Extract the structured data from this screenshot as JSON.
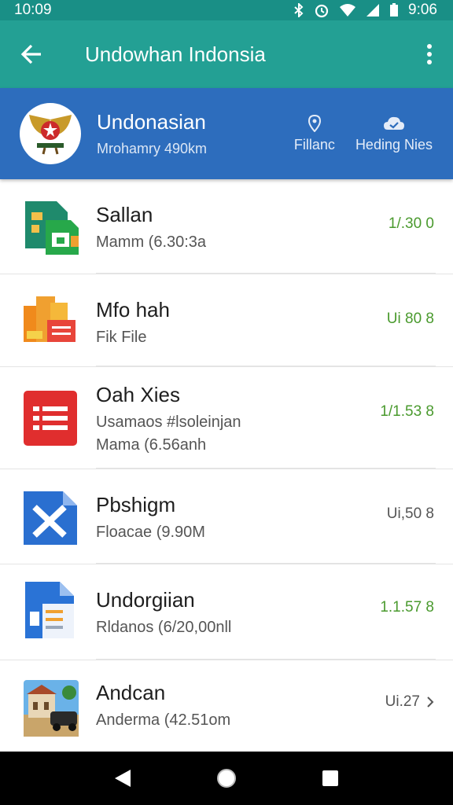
{
  "status_bar": {
    "time_left": "10:09",
    "time_right": "9:06"
  },
  "app_bar": {
    "title": "Undowhan Indonsia"
  },
  "account": {
    "name": "Undonasian",
    "meta": "Mrohamry 490km",
    "actions": [
      {
        "label": "Fillanc",
        "icon": "pin-icon"
      },
      {
        "label": "Heding Nies",
        "icon": "cloud-sync-icon"
      }
    ]
  },
  "files": [
    {
      "name": "Sallan",
      "sub1": "Mamm (6.30:3a",
      "sub2": "",
      "value": "1/.30 0",
      "value_color": "#4a9a2e",
      "icon": "sheets-file-icon"
    },
    {
      "name": "Mfo hah",
      "sub1": "Fik File",
      "sub2": "",
      "value": "Ui 80 8",
      "value_color": "#4a9a2e",
      "icon": "slides-file-icon"
    },
    {
      "name": "Oah Xies",
      "sub1": "Usamaos #lsoleinjan",
      "sub2": "Mama (6.56anh",
      "value": "1/1.53 8",
      "value_color": "#4a9a2e",
      "icon": "docs-list-icon"
    },
    {
      "name": "Pbshigm",
      "sub1": "Floacae (9.90M",
      "sub2": "",
      "value": "Ui,50 8",
      "value_color": "#555555",
      "icon": "excel-x-icon"
    },
    {
      "name": "Undorgiian",
      "sub1": "Rldanos (6/20,00nll",
      "sub2": "",
      "value": "1.1.57 8",
      "value_color": "#4a9a2e",
      "icon": "document-file-icon"
    },
    {
      "name": "Andcan",
      "sub1": "Anderma (42.51om",
      "sub2": "",
      "value": "Ui.27",
      "value_color": "#555555",
      "icon": "image-thumbnail-icon"
    }
  ],
  "colors": {
    "app_bar": "#23a094",
    "header": "#2d6dbd",
    "accent_green": "#4a9a2e"
  }
}
